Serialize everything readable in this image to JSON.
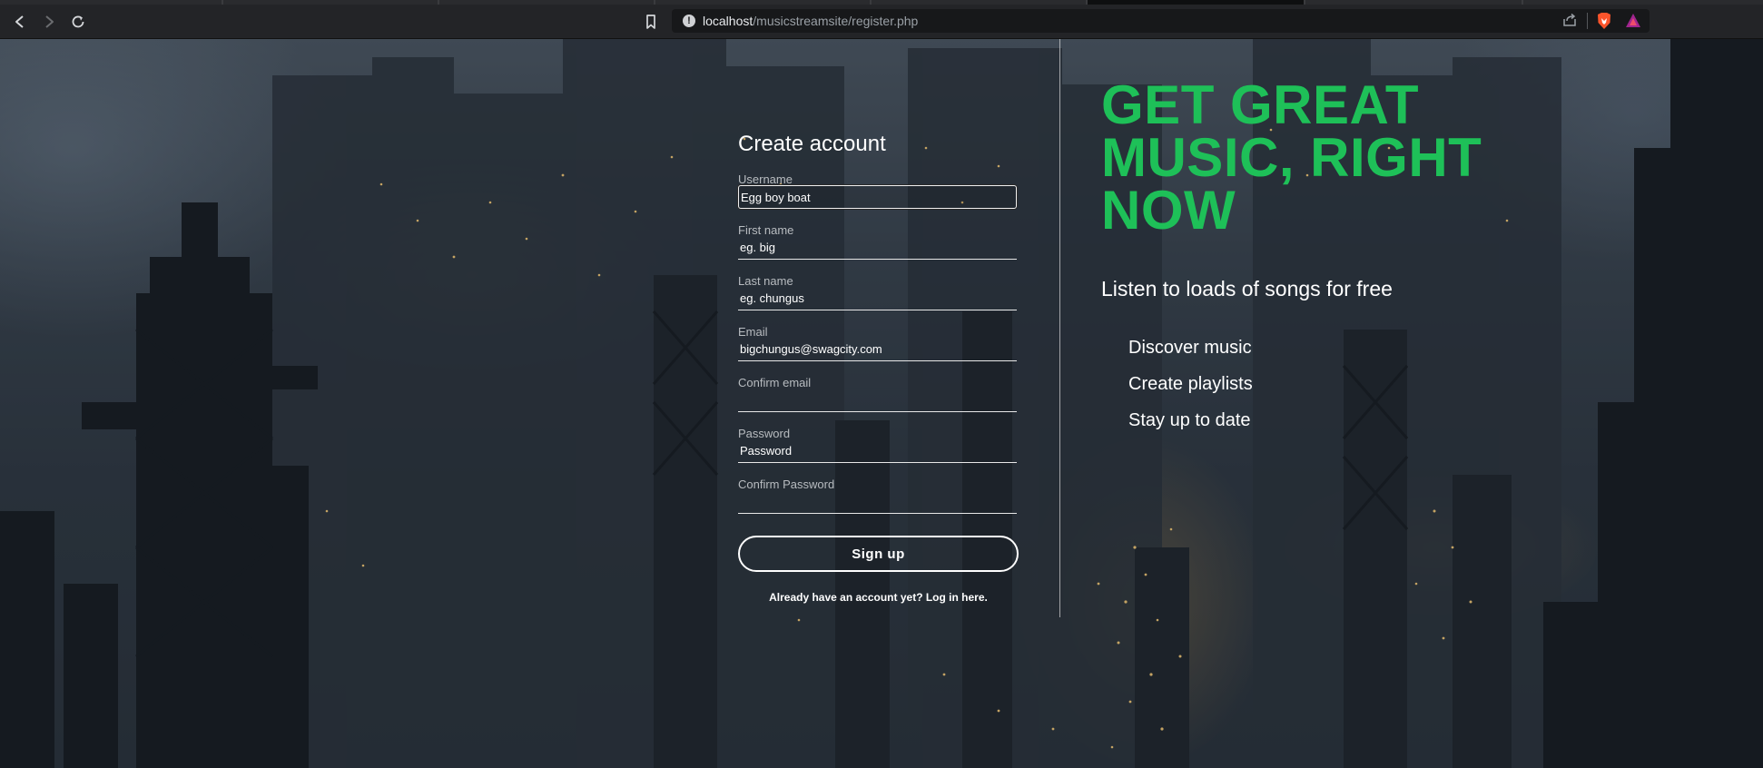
{
  "browser": {
    "url_host": "localhost",
    "url_path": "/musicstreamsite/register.php",
    "back_icon": "back-arrow-icon",
    "forward_icon": "forward-arrow-icon",
    "reload_icon": "reload-icon",
    "bookmark_icon": "bookmark-icon",
    "info_icon": "info-icon",
    "share_icon": "share-icon",
    "shield_icon": "brave-shield-icon",
    "rewards_icon": "brave-rewards-icon"
  },
  "register": {
    "title": "Create account",
    "fields": [
      {
        "label": "Username",
        "value": "Egg boy boat",
        "placeholder": ""
      },
      {
        "label": "First name",
        "value": "",
        "placeholder": "eg. big"
      },
      {
        "label": "Last name",
        "value": "",
        "placeholder": "eg. chungus"
      },
      {
        "label": "Email",
        "value": "",
        "placeholder": "bigchungus@swagcity.com"
      },
      {
        "label": "Confirm email",
        "value": "",
        "placeholder": ""
      },
      {
        "label": "Password",
        "value": "",
        "placeholder": "Password"
      },
      {
        "label": "Confirm Password",
        "value": "",
        "placeholder": ""
      }
    ],
    "signup_label": "Sign up",
    "login_link": "Already have an account yet? Log in here."
  },
  "promo": {
    "headline": "GET GREAT MUSIC, RIGHT NOW",
    "subheadline": "Listen to loads of songs for free",
    "features": [
      "Discover music",
      "Create playlists",
      "Stay up to date"
    ]
  },
  "colors": {
    "accent_green": "#1ec058",
    "text": "#ffffff"
  }
}
